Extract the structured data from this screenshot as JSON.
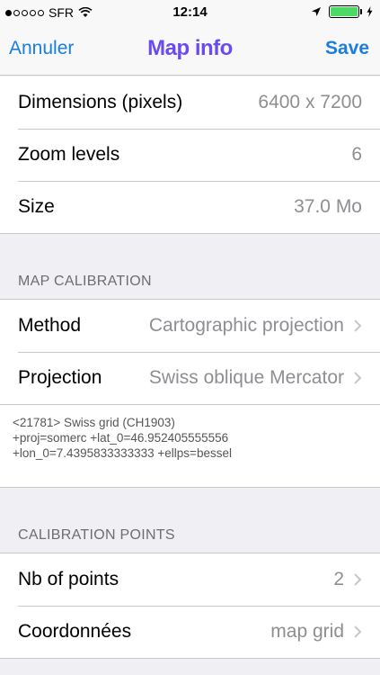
{
  "status_bar": {
    "carrier": "SFR",
    "time": "12:14"
  },
  "nav": {
    "left_label": "Annuler",
    "title": "Map info",
    "right_label": "Save"
  },
  "info": {
    "rows": [
      {
        "label": "Dimensions (pixels)",
        "value": "6400 x 7200"
      },
      {
        "label": "Zoom levels",
        "value": "6"
      },
      {
        "label": "Size",
        "value": "37.0 Mo"
      }
    ]
  },
  "calibration": {
    "header": "MAP CALIBRATION",
    "method": {
      "label": "Method",
      "value": "Cartographic projection"
    },
    "projection": {
      "label": "Projection",
      "value": "Swiss oblique Mercator"
    },
    "detail_lines": [
      "<21781> Swiss grid (CH1903)",
      "+proj=somerc +lat_0=46.952405555556",
      "+lon_0=7.4395833333333 +ellps=bessel"
    ]
  },
  "points": {
    "header": "CALIBRATION POINTS",
    "nb": {
      "label": "Nb of points",
      "value": "2"
    },
    "coords": {
      "label": "Coordonnées",
      "value": "map grid"
    }
  },
  "colors": {
    "accent": "#1a7ee0",
    "title": "#6a4bf0",
    "battery": "#4cd964"
  },
  "icons": {
    "wifi": "wifi-icon",
    "location": "location-arrow-icon",
    "battery": "battery-icon",
    "charging": "charging-bolt-icon",
    "chevron": "chevron-right-icon"
  }
}
